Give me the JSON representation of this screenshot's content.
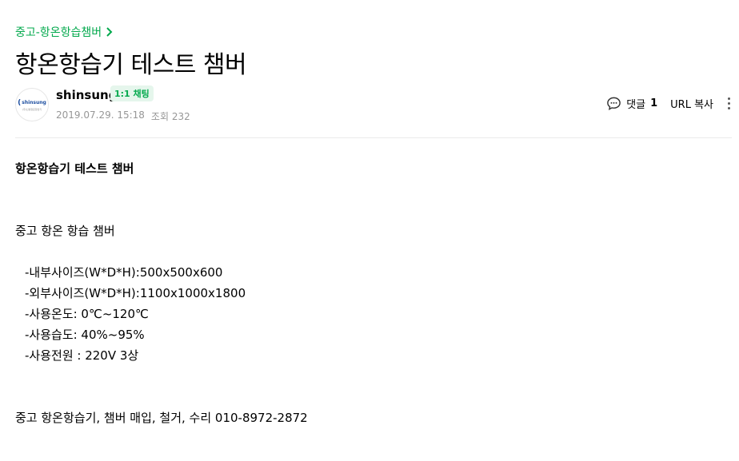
{
  "breadcrumb": {
    "label": "중고-항온항습챔버"
  },
  "post": {
    "title": "항온항습기 테스트 챔버",
    "author": "shinsung",
    "chat_badge": "1:1 채팅",
    "date": "2019.07.29. 15:18",
    "views_label": "조회 232",
    "avatar_logo": "shinsung",
    "avatar_sub": "(주)신성항온항습기"
  },
  "actions": {
    "comment_label": "댓글",
    "comment_count": "1",
    "url_copy": "URL 복사"
  },
  "content": {
    "heading": "항온항습기 테스트 챔버",
    "intro": "중고 항온 항습 챔버",
    "specs": [
      "-내부사이즈(W*D*H):500x500x600",
      "-외부사이즈(W*D*H):1100x1000x1800",
      "-사용온도: 0℃~120℃",
      "-사용습도: 40%~95%",
      "-사용전원 : 220V 3상"
    ],
    "footer": "중고 항온항습기, 챔버 매입, 철거, 수리 010-8972-2872"
  },
  "colors": {
    "accent": "#03a94d",
    "meta": "#979797",
    "badge_bg": "#e5f6ec"
  }
}
